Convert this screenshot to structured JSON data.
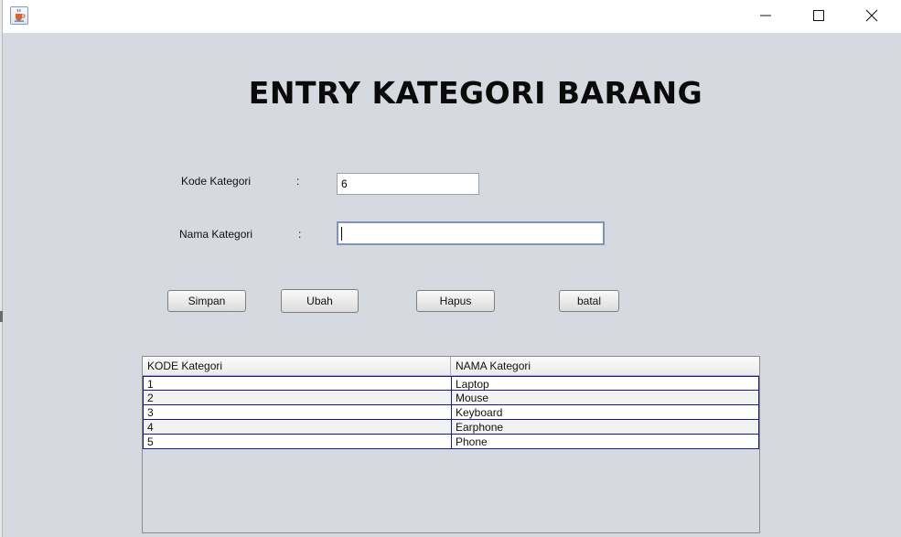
{
  "window": {
    "app_icon": "java-coffee-cup-icon",
    "controls": [
      "minimize-icon",
      "maximize-icon",
      "close-icon"
    ]
  },
  "form": {
    "title": "ENTRY KATEGORI BARANG",
    "kode_label": "Kode Kategori",
    "kode_colon": ":",
    "kode_value": "6",
    "nama_label": "Nama Kategori",
    "nama_colon": ":",
    "nama_value": ""
  },
  "buttons": {
    "simpan": "Simpan",
    "ubah": "Ubah",
    "hapus": "Hapus",
    "batal": "batal"
  },
  "table": {
    "columns": [
      "KODE Kategori",
      "NAMA Kategori"
    ],
    "rows": [
      [
        "1",
        "Laptop"
      ],
      [
        "2",
        "Mouse"
      ],
      [
        "3",
        "Keyboard"
      ],
      [
        "4",
        "Earphone"
      ],
      [
        "5",
        "Phone"
      ]
    ]
  },
  "colors": {
    "panel_bg": "#d6d9df",
    "row_border": "#1a1a8c",
    "focus_border": "#7a96bd"
  }
}
